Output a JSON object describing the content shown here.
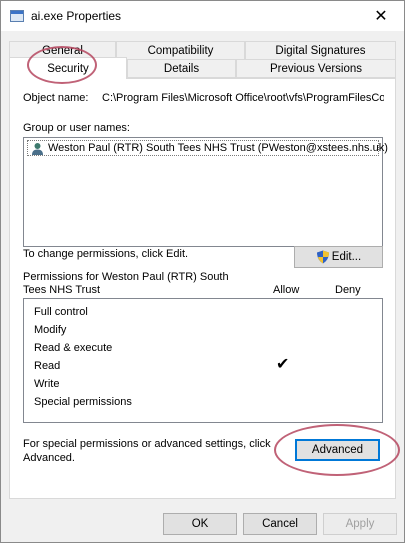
{
  "window": {
    "title": "ai.exe Properties",
    "close_glyph": "✕"
  },
  "tabs": {
    "row1": [
      "General",
      "Compatibility",
      "Digital Signatures"
    ],
    "row2": [
      "Security",
      "Details",
      "Previous Versions"
    ]
  },
  "security": {
    "object_name_label": "Object name:",
    "object_name_value": "C:\\Program Files\\Microsoft Office\\root\\vfs\\ProgramFilesCon",
    "group_label": "Group or user names:",
    "users": [
      {
        "name": "Weston Paul (RTR) South Tees NHS Trust (PWeston@xstees.nhs.uk)",
        "icon": "user-icon"
      }
    ],
    "change_text": "To change permissions, click Edit.",
    "edit_button": "Edit...",
    "permissions_for_line1": "Permissions for Weston Paul (RTR) South",
    "permissions_for_line2": "Tees NHS Trust",
    "allow_header": "Allow",
    "deny_header": "Deny",
    "permissions": [
      {
        "name": "Full control",
        "allow": ""
      },
      {
        "name": "Modify",
        "allow": ""
      },
      {
        "name": "Read & execute",
        "allow": ""
      },
      {
        "name": "Read",
        "allow": "✔"
      },
      {
        "name": "Write",
        "allow": ""
      },
      {
        "name": "Special permissions",
        "allow": ""
      }
    ],
    "advanced_text_line1": "For special permissions or advanced settings, click",
    "advanced_text_line2": "Advanced.",
    "advanced_button": "Advanced"
  },
  "footer": {
    "ok": "OK",
    "cancel": "Cancel",
    "apply": "Apply"
  },
  "colors": {
    "annotation": "#b5465f",
    "focus": "#0078d7"
  }
}
